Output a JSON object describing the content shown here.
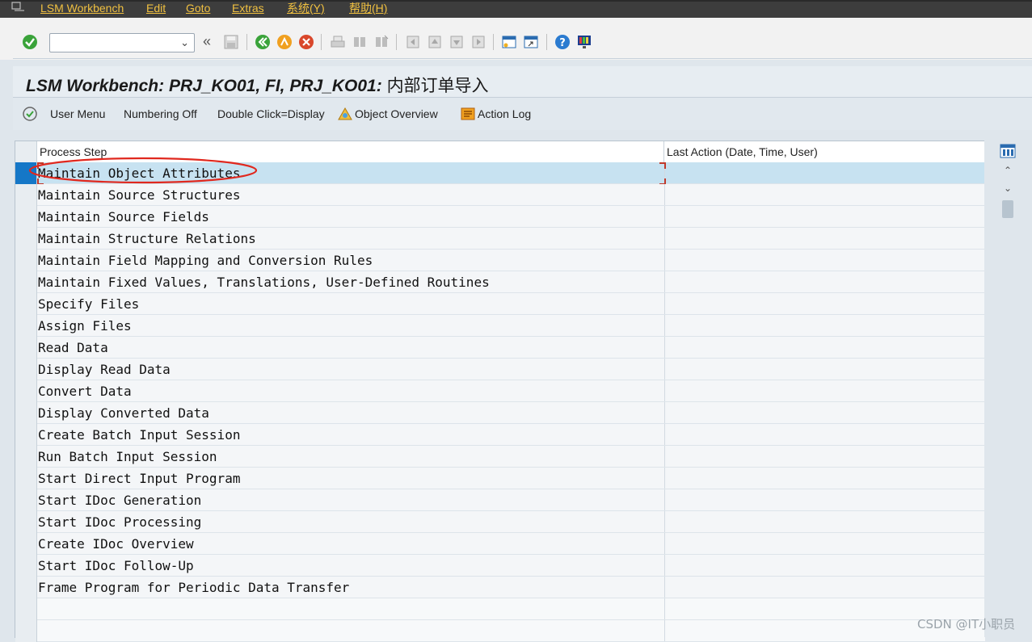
{
  "menu": {
    "items": [
      "LSM Workbench",
      "Edit",
      "Goto",
      "Extras",
      "系统(Y)",
      "帮助(H)"
    ]
  },
  "toolbar": {
    "command_field_value": "",
    "dropdown_icon": "chevron-down-icon",
    "icons": [
      "enter-icon",
      "save-icon",
      "back-icon",
      "exit-icon",
      "cancel-icon",
      "print-icon",
      "find-icon",
      "find-next-icon",
      "first-page-icon",
      "prev-page-icon",
      "next-page-icon",
      "last-page-icon",
      "new-session-icon",
      "shortcut-icon",
      "help-icon",
      "customize-layout-icon"
    ]
  },
  "title": {
    "main": "LSM Workbench: PRJ_KO01, FI, PRJ_KO01: ",
    "cn": "内部订单导入"
  },
  "app_toolbar": {
    "user_menu": "User Menu",
    "numbering_off": "Numbering Off",
    "double_click": "Double Click=Display",
    "object_overview": "Object Overview",
    "action_log": "Action Log"
  },
  "table": {
    "headers": {
      "process_step": "Process Step",
      "last_action": "Last Action (Date, Time, User)"
    },
    "rows": [
      "Maintain Object Attributes",
      "Maintain Source Structures",
      "Maintain Source Fields",
      "Maintain Structure Relations",
      "Maintain Field Mapping and Conversion Rules",
      "Maintain Fixed Values, Translations, User-Defined Routines",
      "Specify Files",
      "Assign Files",
      "Read Data",
      "Display Read Data",
      "Convert Data",
      "Display Converted Data",
      "Create Batch Input Session",
      "Run Batch Input Session",
      "Start Direct Input Program",
      "Start IDoc Generation",
      "Start IDoc Processing",
      "Create IDoc Overview",
      "Start IDoc Follow-Up",
      "Frame Program for Periodic Data Transfer"
    ],
    "selected_row": "Maintain Object Attributes"
  },
  "watermark": "CSDN @IT小职员",
  "colors": {
    "menu_bg": "#3d3d3d",
    "menu_text": "#f0c040",
    "selection": "#c7e2f1",
    "selection_marker": "#1577c7",
    "annotation": "#e0281e"
  }
}
